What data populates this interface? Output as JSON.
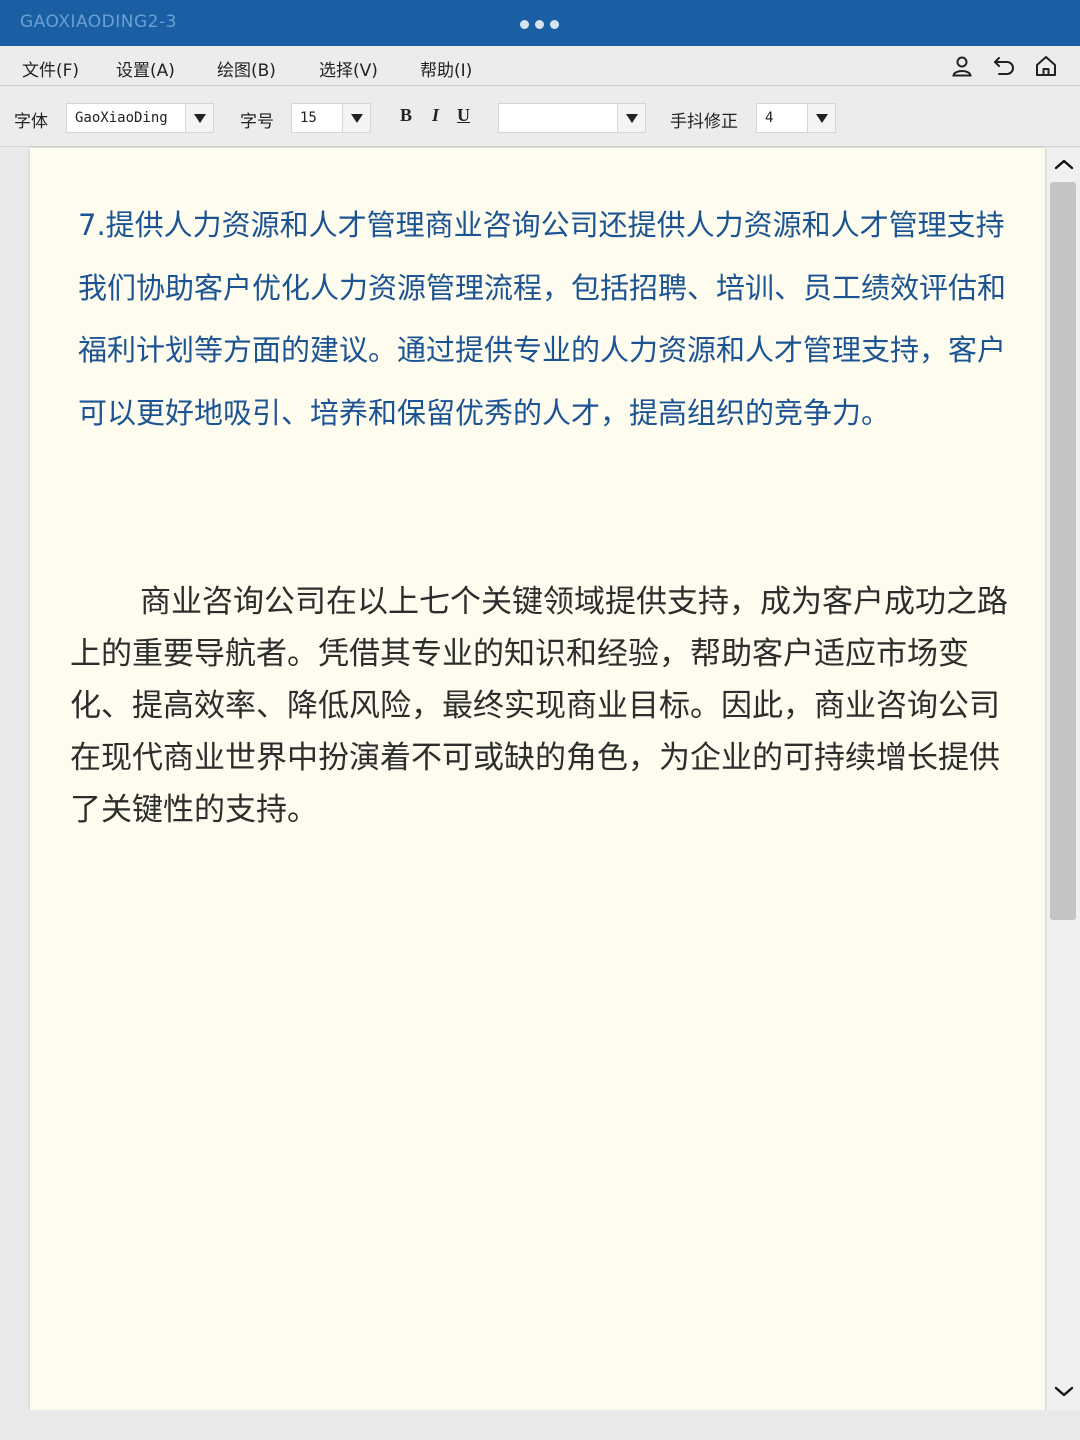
{
  "window": {
    "title": "GAOXIAODING2-3"
  },
  "menu": {
    "file": "文件(F)",
    "settings": "设置(A)",
    "draw": "绘图(B)",
    "select": "选择(V)",
    "help": "帮助(I)"
  },
  "toolbar": {
    "font_label": "字体",
    "font_value": "GaoXiaoDing",
    "size_label": "字号",
    "size_value": "15",
    "bold": "B",
    "italic": "I",
    "underline": "U",
    "color_value": "",
    "jitter_label": "手抖修正",
    "jitter_value": "4"
  },
  "document": {
    "para1": "7.提供人力资源和人才管理商业咨询公司还提供人力资源和人才管理支持我们协助客户优化人力资源管理流程，包括招聘、培训、员工绩效评估和福利计划等方面的建议。通过提供专业的人力资源和人才管理支持，客户可以更好地吸引、培养和保留优秀的人才，提高组织的竞争力。",
    "para2": "商业咨询公司在以上七个关键领域提供支持，成为客户成功之路上的重要导航者。凭借其专业的知识和经验，帮助客户适应市场变化、提高效率、降低风险，最终实现商业目标。因此，商业咨询公司在现代商业世界中扮演着不可或缺的角色，为企业的可持续增长提供了关键性的支持。"
  },
  "colors": {
    "titlebar": "#1a5fa3",
    "para1_text": "#1c5493",
    "para2_text": "#2d2d2d",
    "page_bg": "#fefcee"
  },
  "icons": {
    "user": "user-icon",
    "undo": "undo-icon",
    "home": "home-icon",
    "scroll_up": "chevron-up-icon",
    "scroll_down": "chevron-down-icon"
  }
}
